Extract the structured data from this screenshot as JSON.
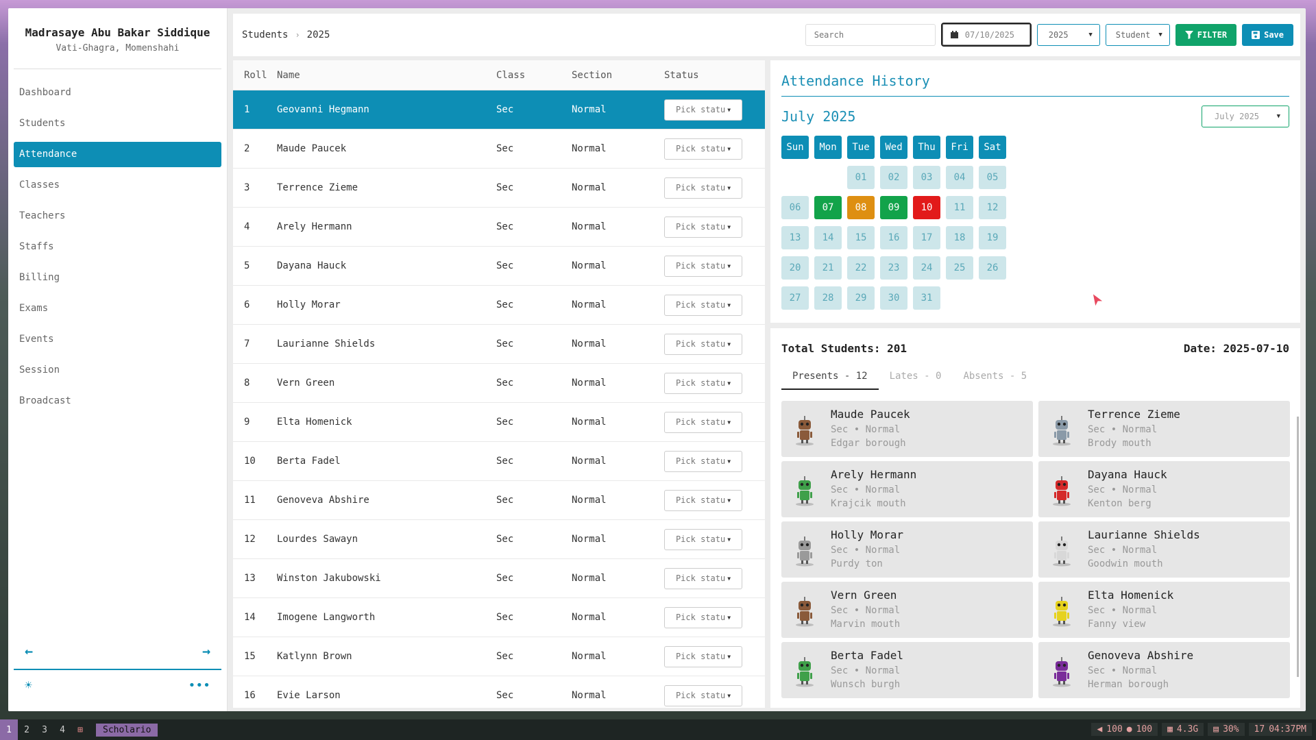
{
  "brand": {
    "title": "Madrasaye Abu Bakar Siddique",
    "subtitle": "Vati-Ghagra, Momenshahi"
  },
  "sidebar": {
    "items": [
      {
        "label": "Dashboard"
      },
      {
        "label": "Students"
      },
      {
        "label": "Attendance"
      },
      {
        "label": "Classes"
      },
      {
        "label": "Teachers"
      },
      {
        "label": "Staffs"
      },
      {
        "label": "Billing"
      },
      {
        "label": "Exams"
      },
      {
        "label": "Events"
      },
      {
        "label": "Session"
      },
      {
        "label": "Broadcast"
      }
    ],
    "active": "Attendance",
    "arrow_back": "←",
    "arrow_forward": "→",
    "theme_icon": "☀",
    "more_icon": "•••"
  },
  "breadcrumb": {
    "root": "Students",
    "sep": "›",
    "current": "2025"
  },
  "toolbar": {
    "search_placeholder": "Search",
    "date_value": "07/10/2025",
    "year_value": "2025",
    "type_value": "Student",
    "filter_label": "FILTER",
    "save_label": "Save"
  },
  "table": {
    "headers": [
      "Roll",
      "Name",
      "Class",
      "Section",
      "Status"
    ],
    "pick_label": "Pick statu",
    "rows": [
      {
        "roll": "1",
        "name": "Geovanni Hegmann",
        "class": "Sec",
        "section": "Normal"
      },
      {
        "roll": "2",
        "name": "Maude Paucek",
        "class": "Sec",
        "section": "Normal"
      },
      {
        "roll": "3",
        "name": "Terrence Zieme",
        "class": "Sec",
        "section": "Normal"
      },
      {
        "roll": "4",
        "name": "Arely Hermann",
        "class": "Sec",
        "section": "Normal"
      },
      {
        "roll": "5",
        "name": "Dayana Hauck",
        "class": "Sec",
        "section": "Normal"
      },
      {
        "roll": "6",
        "name": "Holly Morar",
        "class": "Sec",
        "section": "Normal"
      },
      {
        "roll": "7",
        "name": "Laurianne Shields",
        "class": "Sec",
        "section": "Normal"
      },
      {
        "roll": "8",
        "name": "Vern Green",
        "class": "Sec",
        "section": "Normal"
      },
      {
        "roll": "9",
        "name": "Elta Homenick",
        "class": "Sec",
        "section": "Normal"
      },
      {
        "roll": "10",
        "name": "Berta Fadel",
        "class": "Sec",
        "section": "Normal"
      },
      {
        "roll": "11",
        "name": "Genoveva Abshire",
        "class": "Sec",
        "section": "Normal"
      },
      {
        "roll": "12",
        "name": "Lourdes Sawayn",
        "class": "Sec",
        "section": "Normal"
      },
      {
        "roll": "13",
        "name": "Winston Jakubowski",
        "class": "Sec",
        "section": "Normal"
      },
      {
        "roll": "14",
        "name": "Imogene Langworth",
        "class": "Sec",
        "section": "Normal"
      },
      {
        "roll": "15",
        "name": "Katlynn Brown",
        "class": "Sec",
        "section": "Normal"
      },
      {
        "roll": "16",
        "name": "Evie Larson",
        "class": "Sec",
        "section": "Normal"
      }
    ]
  },
  "history": {
    "title": "Attendance History",
    "month_title": "July 2025",
    "month_select": "July 2025",
    "weekdays": [
      "Sun",
      "Mon",
      "Tue",
      "Wed",
      "Thu",
      "Fri",
      "Sat"
    ],
    "first_weekday_index": 2,
    "days": [
      "01",
      "02",
      "03",
      "04",
      "05",
      "06",
      "07",
      "08",
      "09",
      "10",
      "11",
      "12",
      "13",
      "14",
      "15",
      "16",
      "17",
      "18",
      "19",
      "20",
      "21",
      "22",
      "23",
      "24",
      "25",
      "26",
      "27",
      "28",
      "29",
      "30",
      "31"
    ],
    "status": {
      "07": "present",
      "08": "late",
      "09": "present",
      "10": "absent"
    },
    "colors": {
      "present": "#12a34a",
      "late": "#de8f12",
      "absent": "#e21a1a",
      "accent": "#0d8eb5"
    }
  },
  "summary": {
    "total": "Total Students: 201",
    "date": "Date: 2025-07-10",
    "tabs": [
      "Presents - 12",
      "Lates - 0",
      "Absents - 5"
    ],
    "cards": [
      {
        "name": "Maude Paucek",
        "meta": "Sec • Normal",
        "place": "Edgar borough",
        "avatar": "brown-robot-icon"
      },
      {
        "name": "Terrence Zieme",
        "meta": "Sec • Normal",
        "place": "Brody mouth",
        "avatar": "gray-robot-icon"
      },
      {
        "name": "Arely Hermann",
        "meta": "Sec • Normal",
        "place": "Krajcik mouth",
        "avatar": "green-robot-icon"
      },
      {
        "name": "Dayana Hauck",
        "meta": "Sec • Normal",
        "place": "Kenton berg",
        "avatar": "red-robot-icon"
      },
      {
        "name": "Holly Morar",
        "meta": "Sec • Normal",
        "place": "Purdy ton",
        "avatar": "alien-robot-icon"
      },
      {
        "name": "Laurianne Shields",
        "meta": "Sec • Normal",
        "place": "Goodwin mouth",
        "avatar": "white-robot-icon"
      },
      {
        "name": "Vern Green",
        "meta": "Sec • Normal",
        "place": "Marvin mouth",
        "avatar": "brown-robot-icon"
      },
      {
        "name": "Elta Homenick",
        "meta": "Sec • Normal",
        "place": "Fanny view",
        "avatar": "yellow-robot-icon"
      },
      {
        "name": "Berta Fadel",
        "meta": "Sec • Normal",
        "place": "Wunsch burgh",
        "avatar": "green-robot-icon"
      },
      {
        "name": "Genoveva Abshire",
        "meta": "Sec • Normal",
        "place": "Herman borough",
        "avatar": "purple-robot-icon"
      }
    ]
  },
  "taskbar": {
    "workspaces": [
      "1",
      "2",
      "3",
      "4"
    ],
    "app": "Scholario",
    "volume": "100",
    "mic": "100",
    "memory": "4.3G",
    "cpu": "30%",
    "date_num": "17",
    "time": "04:37PM"
  }
}
